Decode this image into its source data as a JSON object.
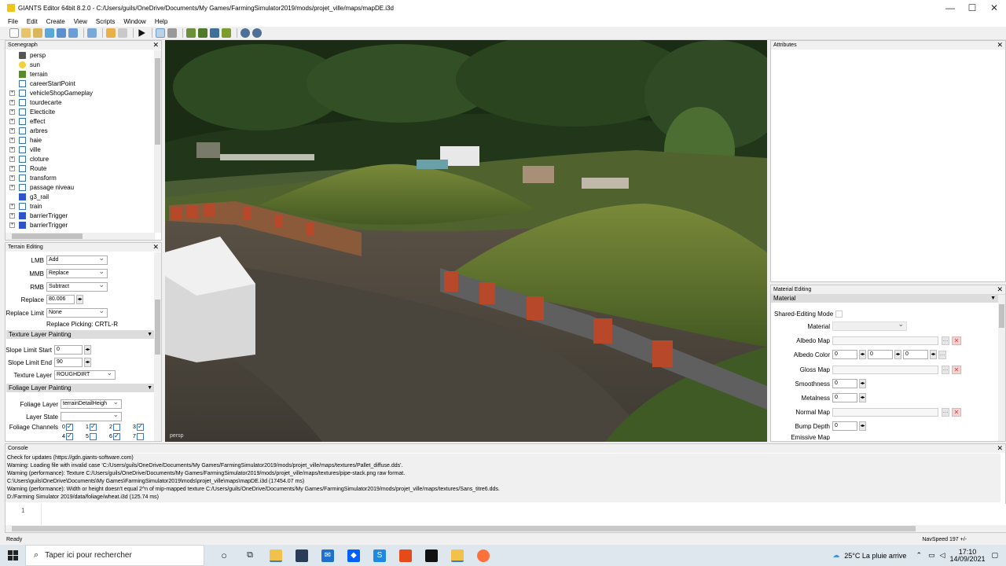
{
  "window": {
    "title": "GIANTS Editor 64bit 8.2.0 - C:/Users/guils/OneDrive/Documents/My Games/FarmingSimulator2019/mods/projet_ville/maps/mapDE.i3d",
    "minimize": "—",
    "maximize": "☐",
    "close": "✕"
  },
  "menu": [
    "File",
    "Edit",
    "Create",
    "View",
    "Scripts",
    "Window",
    "Help"
  ],
  "scenegraph": {
    "title": "Scenegraph",
    "items": [
      {
        "label": "persp",
        "icon": "camera-icon",
        "expandable": false
      },
      {
        "label": "sun",
        "icon": "light-icon",
        "expandable": false
      },
      {
        "label": "terrain",
        "icon": "terrain-icon",
        "expandable": false
      },
      {
        "label": "careerStartPoint",
        "icon": "transform-group-icon",
        "expandable": false
      },
      {
        "label": "vehicleShopGameplay",
        "icon": "transform-group-icon",
        "expandable": true
      },
      {
        "label": "tourdecarte",
        "icon": "transform-group-icon",
        "expandable": true
      },
      {
        "label": "Electicite",
        "icon": "transform-group-icon",
        "expandable": true
      },
      {
        "label": "effect",
        "icon": "transform-group-icon",
        "expandable": true
      },
      {
        "label": "arbres",
        "icon": "transform-group-icon",
        "expandable": true
      },
      {
        "label": "haie",
        "icon": "transform-group-icon",
        "expandable": true
      },
      {
        "label": "ville",
        "icon": "transform-group-icon",
        "expandable": true
      },
      {
        "label": "cloture",
        "icon": "transform-group-icon",
        "expandable": true
      },
      {
        "label": "Route",
        "icon": "transform-group-icon",
        "expandable": true
      },
      {
        "label": "transform",
        "icon": "transform-group-icon",
        "expandable": true
      },
      {
        "label": "passage niveau",
        "icon": "transform-group-icon",
        "expandable": true
      },
      {
        "label": "g3_rail",
        "icon": "shape-icon",
        "expandable": false
      },
      {
        "label": "train",
        "icon": "transform-group-icon",
        "expandable": true
      },
      {
        "label": "barrierTrigger",
        "icon": "shape-icon",
        "expandable": true
      },
      {
        "label": "barrierTrigger",
        "icon": "shape-icon",
        "expandable": true
      }
    ]
  },
  "terrain_editing": {
    "title": "Terrain Editing",
    "lmb_label": "LMB",
    "lmb_value": "Add",
    "mmb_label": "MMB",
    "mmb_value": "Replace",
    "rmb_label": "RMB",
    "rmb_value": "Subtract",
    "replace_label": "Replace",
    "replace_value": "80.006",
    "replace_limit_label": "Replace Limit",
    "replace_limit_value": "None",
    "replace_picking": "Replace Picking: CRTL-R",
    "texture_section": "Texture Layer Painting",
    "slope_start_label": "Slope Limit Start",
    "slope_start_value": "0",
    "slope_end_label": "Slope Limit End",
    "slope_end_value": "90",
    "texture_layer_label": "Texture Layer",
    "texture_layer_value": "ROUGHDIRT",
    "foliage_section": "Foliage Layer Painting",
    "foliage_layer_label": "Foliage Layer",
    "foliage_layer_value": "terrainDetailHeigh",
    "layer_state_label": "Layer State",
    "layer_state_value": "",
    "foliage_channels_label": "Foliage Channels",
    "channels": [
      {
        "n": "0",
        "on": true
      },
      {
        "n": "1",
        "on": true
      },
      {
        "n": "2",
        "on": false
      },
      {
        "n": "3",
        "on": true
      },
      {
        "n": "4",
        "on": true
      },
      {
        "n": "5",
        "on": false
      },
      {
        "n": "6",
        "on": true
      },
      {
        "n": "7",
        "on": false
      }
    ]
  },
  "viewport": {
    "camera_label": "persp"
  },
  "attributes": {
    "title": "Attributes"
  },
  "material_editing": {
    "title": "Material Editing",
    "section": "Material",
    "shared_label": "Shared-Editing Mode",
    "material_label": "Material",
    "albedo_map_label": "Albedo Map",
    "albedo_color_label": "Albedo Color",
    "albedo_r": "0",
    "albedo_g": "0",
    "albedo_b": "0",
    "gloss_map_label": "Gloss Map",
    "smoothness_label": "Smoothness",
    "smoothness_value": "0",
    "metalness_label": "Metalness",
    "metalness_value": "0",
    "normal_map_label": "Normal Map",
    "bump_depth_label": "Bump Depth",
    "bump_depth_value": "0",
    "emissive_map_label": "Emissive Map"
  },
  "console": {
    "title": "Console",
    "lines": [
      "Check for updates (https://gdn.giants-software.com)",
      "Warning: Loading file with invalid case 'C:/Users/guils/OneDrive/Documents/My Games/FarmingSimulator2019/mods/projet_ville/maps/textures/Pallet_diffuse.dds'.",
      "Warning (performance): Texture C:/Users/guils/OneDrive/Documents/My Games/FarmingSimulator2019/mods/projet_ville/maps/textures/pipe-stack.png raw format.",
      "C:\\Users\\guils\\OneDrive\\Documents\\My Games\\FarmingSimulator2019\\mods\\projet_ville\\maps\\mapDE.i3d (17454.07 ms)",
      "Warning (performance): Width or height doesn't equal 2^n of mip-mapped texture C:/Users/guils/OneDrive/Documents/My Games/FarmingSimulator2019/mods/projet_ville/maps/textures/Sans_titre6.dds.",
      "D:/Farming Simulator 2019/data/foliage/wheat.i3d (125.74 ms)"
    ],
    "line_number": "1"
  },
  "status": {
    "left": "Ready",
    "right": "NavSpeed 197 +/-"
  },
  "taskbar": {
    "search_placeholder": "Taper ici pour rechercher",
    "weather": "25°C  La pluie arrive",
    "time": "17:10",
    "date": "14/09/2021"
  }
}
